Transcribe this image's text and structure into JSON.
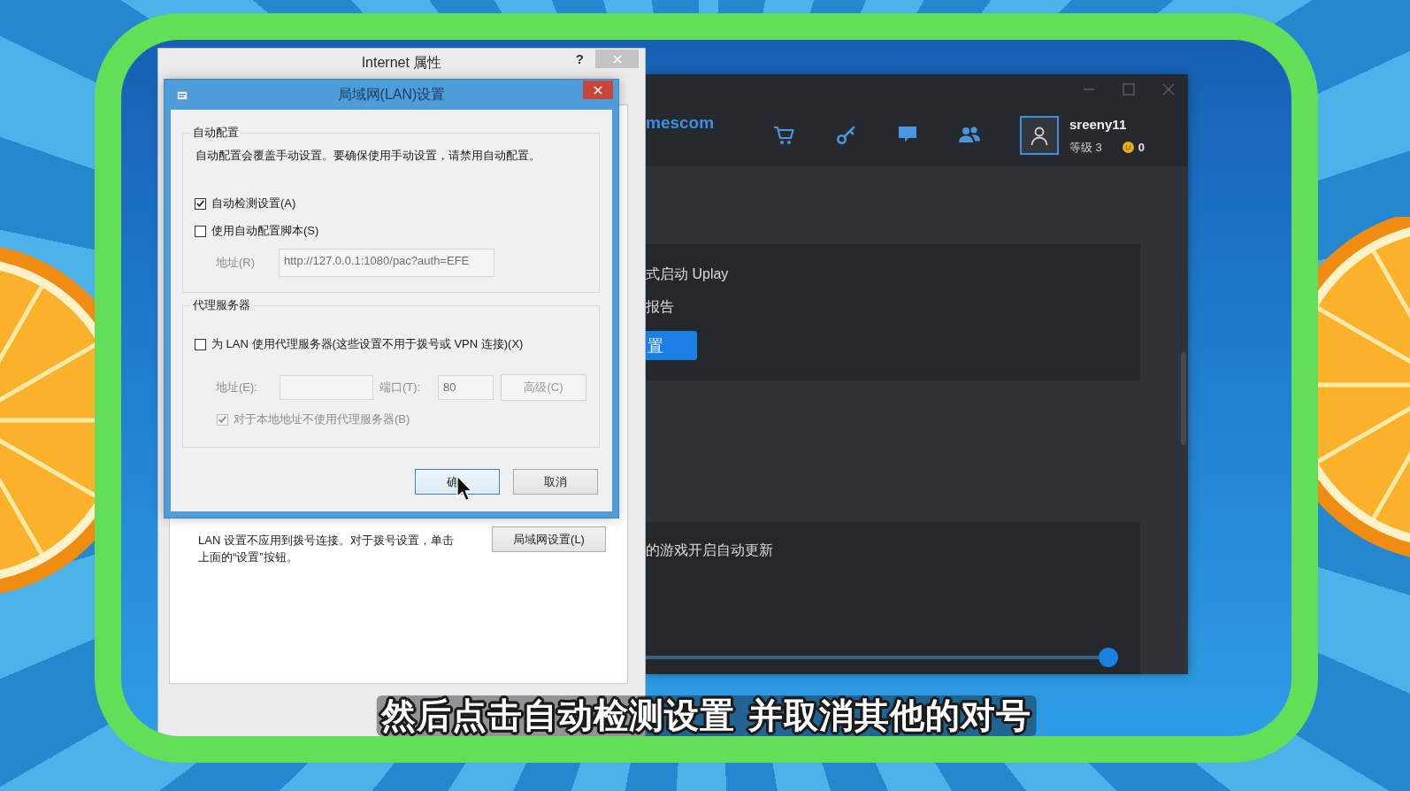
{
  "internet_window": {
    "title": "Internet 属性",
    "help": "?",
    "note": "LAN 设置不应用到拨号连接。对于拨号设置，单击上面的“设置”按钮。",
    "lan_settings_button": "局域网设置(L)"
  },
  "lan_dialog": {
    "title": "局域网(LAN)设置",
    "auto_config": {
      "heading": "自动配置",
      "description": "自动配置会覆盖手动设置。要确保使用手动设置，请禁用自动配置。",
      "options": [
        {
          "label": "自动检测设置(A)",
          "checked": true,
          "disabled": false
        },
        {
          "label": "使用自动配置脚本(S)",
          "checked": false,
          "disabled": false
        }
      ],
      "script_address": {
        "label": "地址(R)",
        "value": "http://127.0.0.1:1080/pac?auth=EFE",
        "disabled": true
      }
    },
    "proxy": {
      "heading": "代理服务器",
      "use_proxy": {
        "label": "为 LAN 使用代理服务器(这些设置不用于拨号或 VPN 连接)(X)",
        "checked": false,
        "disabled": false
      },
      "address": {
        "label": "地址(E):",
        "disabled": true
      },
      "port": {
        "label": "端口(T):",
        "value": "80",
        "disabled": true
      },
      "advanced": {
        "label": "高级(C)",
        "disabled": true
      },
      "bypass_local": {
        "label": "对于本地地址不使用代理服务器(B)",
        "checked": true,
        "disabled": true
      }
    },
    "buttons": [
      {
        "label": "确",
        "focused": true
      },
      {
        "label": "取消",
        "focused": false
      }
    ]
  },
  "app_window": {
    "brand": "mescom",
    "user": {
      "name": "sreeny11",
      "rank": "等级 3",
      "coins": "0"
    },
    "panels": [
      {
        "items": [
          {
            "kind": "text",
            "text": "式启动 Uplay"
          },
          {
            "kind": "text",
            "text": "报告"
          },
          {
            "kind": "button",
            "text": "置"
          }
        ]
      },
      {
        "items": [
          {
            "kind": "text",
            "text": "的游戏开启自动更新"
          },
          {
            "kind": "slider",
            "level": 1
          }
        ]
      }
    ]
  },
  "subtitle": "然后点击自动检测设置 并取消其他的对号"
}
